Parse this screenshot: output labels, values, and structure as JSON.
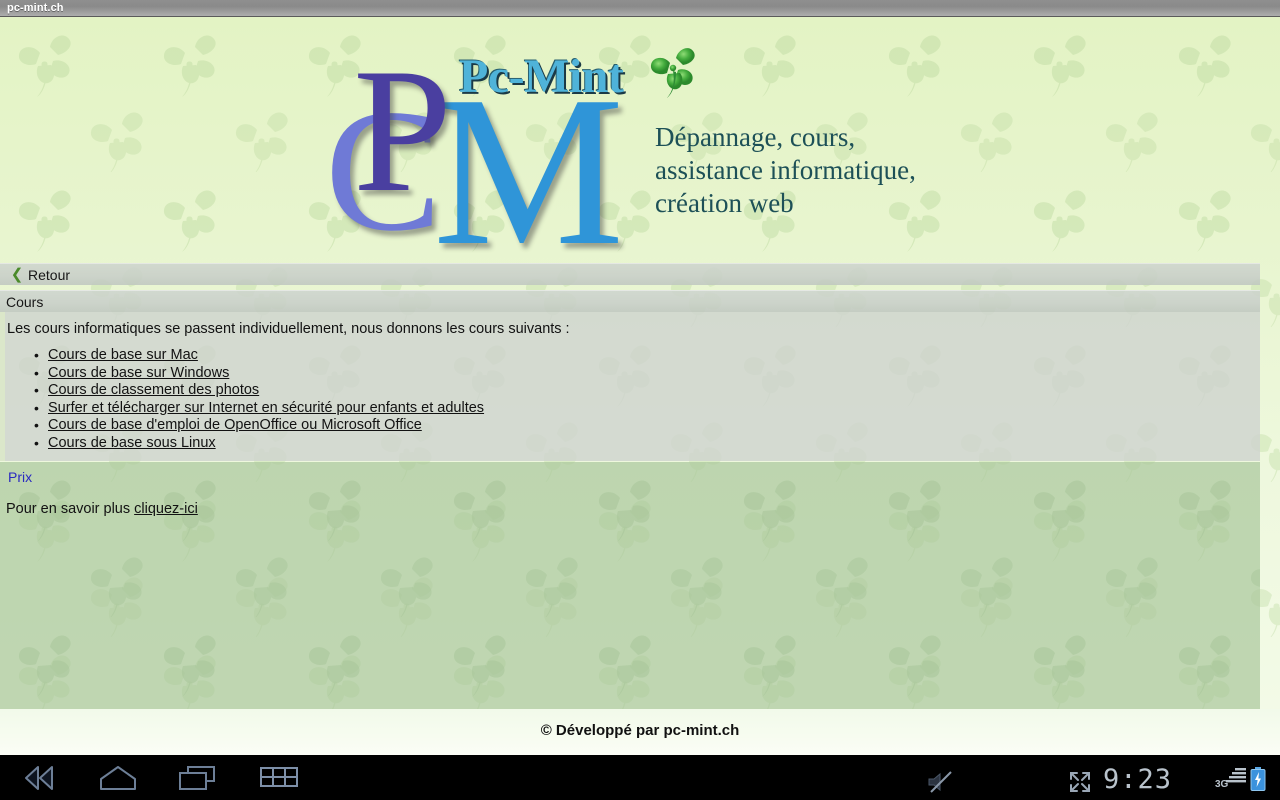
{
  "browser": {
    "title": "pc-mint.ch"
  },
  "header": {
    "logo_letters": {
      "c": "C",
      "p": "P",
      "m": "M"
    },
    "brand_name": "Pc-Mint",
    "clover_icon": "four-leaf-clover-icon",
    "tagline": "Dépannage, cours,\nassistance informatique,\ncréation web"
  },
  "nav": {
    "back_label": "Retour",
    "back_icon": "chevron-left-icon",
    "section_title": "Cours"
  },
  "main": {
    "intro": "Les cours informatiques se passent individuellement, nous donnons les cours suivants :",
    "courses": [
      "Cours de base sur Mac",
      "Cours de base sur Windows",
      "Cours de classement des photos",
      "Surfer et télécharger sur Internet en sécurité pour enfants et adultes",
      "Cours de base d'emploi de OpenOffice ou Microsoft Office",
      "Cours de base sous Linux"
    ]
  },
  "info": {
    "prix_label": "Prix",
    "more_prefix": "Pour en savoir plus ",
    "more_link": "cliquez-ici"
  },
  "footer": {
    "copyright": "© Développé par pc-mint.ch"
  },
  "system_bar": {
    "back_icon": "android-back-icon",
    "home_icon": "android-home-icon",
    "recent_icon": "android-recent-apps-icon",
    "apps_icon": "android-apps-grid-icon",
    "mute_icon": "speaker-muted-icon",
    "expand_icon": "fullscreen-expand-icon",
    "clock": "9:23",
    "network": "3G",
    "signal_icon": "signal-bars-icon",
    "battery_icon": "battery-charging-icon"
  },
  "colors": {
    "page_background": "#eef7d9",
    "bar_background": "#ced4ce",
    "content_background": "#ced3ce",
    "green_panel": "#aac79c",
    "link_blue": "#2a2ac0",
    "logo_purple": "#4a3fa0",
    "logo_light_purple": "#6f7ad6",
    "logo_blue": "#2f95d8",
    "brand_cyan": "#4fb3d9",
    "tagline_teal": "#1d5057",
    "clover_green": "#3fa03f",
    "system_bar": "#000000",
    "status_text": "#b9c3cc"
  }
}
